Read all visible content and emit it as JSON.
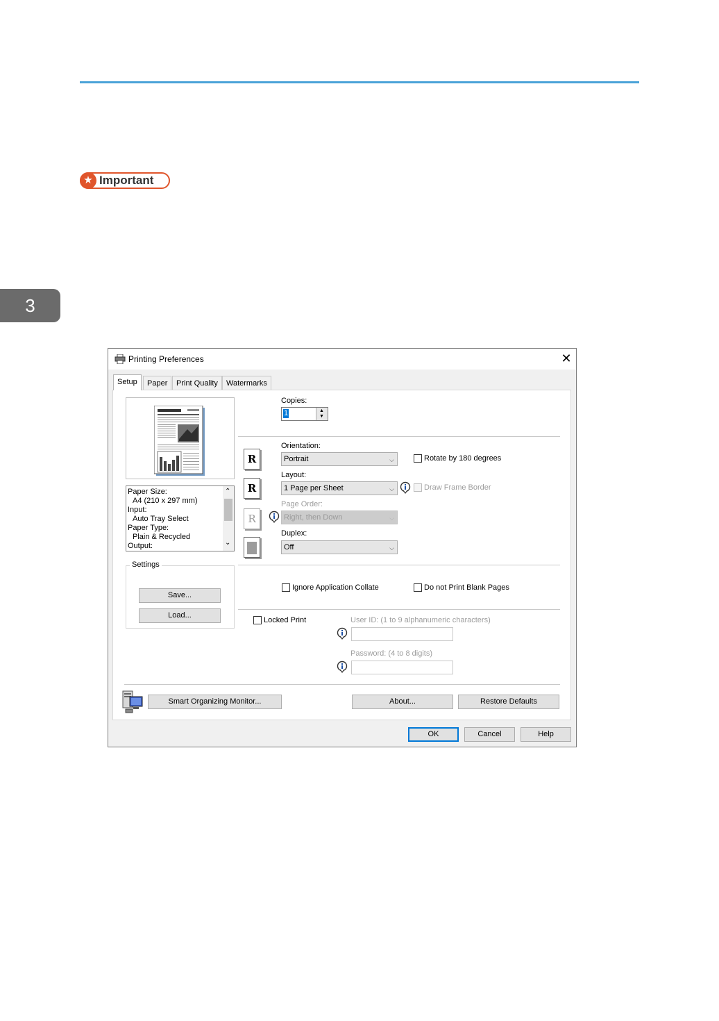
{
  "page": {
    "chapter_number": "3",
    "important_label": "Important",
    "accent_color": "#4aa3d8",
    "important_color": "#e0552b"
  },
  "dialog": {
    "title": "Printing Preferences",
    "close_glyph": "✕",
    "tabs": [
      "Setup",
      "Paper",
      "Print Quality",
      "Watermarks"
    ],
    "active_tab": "Setup",
    "summary": {
      "lines": [
        "Paper Size:",
        " A4 (210 x 297 mm)",
        "Input:",
        " Auto Tray Select",
        "Paper Type:",
        " Plain & Recycled",
        "Output:"
      ]
    },
    "settings": {
      "group_label": "Settings",
      "save_label": "Save...",
      "load_label": "Load..."
    },
    "copies": {
      "label": "Copies:",
      "value": "1"
    },
    "orientation": {
      "label": "Orientation:",
      "value": "Portrait"
    },
    "rotate": {
      "label": "Rotate by 180 degrees",
      "checked": false
    },
    "layout": {
      "label": "Layout:",
      "value": "1 Page per Sheet"
    },
    "draw_frame": {
      "label": "Draw Frame Border",
      "checked": false,
      "enabled": false
    },
    "page_order": {
      "label": "Page Order:",
      "value": "Right, then Down",
      "enabled": false
    },
    "duplex": {
      "label": "Duplex:",
      "value": "Off"
    },
    "ignore_collate": {
      "label": "Ignore Application Collate",
      "checked": false
    },
    "blank_pages": {
      "label": "Do not Print Blank Pages",
      "checked": false
    },
    "locked_print": {
      "label": "Locked Print",
      "checked": false
    },
    "user_id": {
      "label": "User ID: (1 to 9 alphanumeric characters)",
      "value": ""
    },
    "password": {
      "label": "Password: (4 to 8 digits)",
      "value": ""
    },
    "preview_icon_letter": "R",
    "buttons": {
      "smart_monitor": "Smart Organizing Monitor...",
      "about": "About...",
      "restore": "Restore Defaults",
      "ok": "OK",
      "cancel": "Cancel",
      "help": "Help"
    }
  }
}
